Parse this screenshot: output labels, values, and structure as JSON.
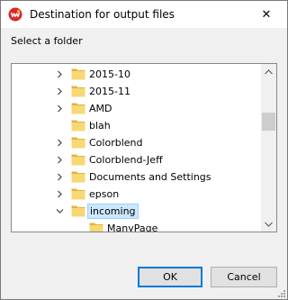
{
  "window": {
    "title": "Destination for output files",
    "close_glyph": "✕"
  },
  "prompt": "Select a folder",
  "tree": {
    "items": [
      {
        "label": "2015-10",
        "expandable": true,
        "expanded": false,
        "selected": false,
        "indent": 0
      },
      {
        "label": "2015-11",
        "expandable": true,
        "expanded": false,
        "selected": false,
        "indent": 0
      },
      {
        "label": "AMD",
        "expandable": true,
        "expanded": false,
        "selected": false,
        "indent": 0
      },
      {
        "label": "blah",
        "expandable": false,
        "expanded": false,
        "selected": false,
        "indent": 0
      },
      {
        "label": "Colorblend",
        "expandable": true,
        "expanded": false,
        "selected": false,
        "indent": 0
      },
      {
        "label": "Colorblend-Jeff",
        "expandable": true,
        "expanded": false,
        "selected": false,
        "indent": 0
      },
      {
        "label": "Documents and Settings",
        "expandable": true,
        "expanded": false,
        "selected": false,
        "indent": 0
      },
      {
        "label": "epson",
        "expandable": true,
        "expanded": false,
        "selected": false,
        "indent": 0
      },
      {
        "label": "incoming",
        "expandable": true,
        "expanded": true,
        "selected": true,
        "indent": 0
      },
      {
        "label": "ManyPage",
        "expandable": false,
        "expanded": false,
        "selected": false,
        "indent": 1
      }
    ]
  },
  "buttons": {
    "ok": "OK",
    "cancel": "Cancel"
  },
  "colors": {
    "selection_bg": "#cce8ff",
    "selection_border": "#99d1ff",
    "folder_fill": "#f8d775",
    "folder_dark": "#e0b33c",
    "primary_border": "#0078d7"
  }
}
